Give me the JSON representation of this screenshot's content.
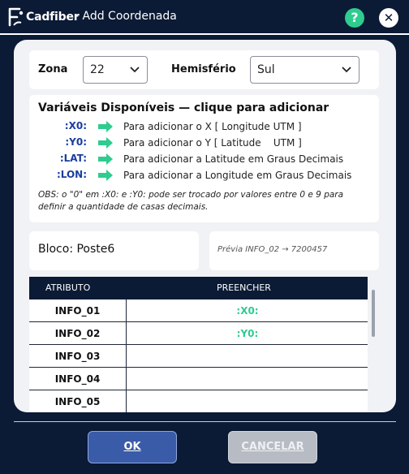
{
  "app": {
    "logo_text": "Cadfiber",
    "window_title": "- Add Coordenada",
    "help_glyph": "?",
    "close_glyph": "✕"
  },
  "zona": {
    "label": "Zona",
    "value": "22"
  },
  "hemisferio": {
    "label": "Hemisfério",
    "value": "Sul"
  },
  "variables": {
    "title": "Variáveis Disponíveis — clique para adicionar",
    "items": [
      {
        "code": ":X0:",
        "desc": "Para adicionar o X [ Longitude UTM ]"
      },
      {
        "code": ":Y0:",
        "desc": "Para adicionar o Y [ Latitude    UTM ]"
      },
      {
        "code": ":LAT:",
        "desc": "Para adicionar a Latitude em Graus Decimais"
      },
      {
        "code": ":LON:",
        "desc": "Para adicionar a Longitude em Graus Decimais"
      }
    ],
    "obs": "OBS: o \"0\" em :X0: e :Y0: pode ser trocado por valores entre 0 e 9 para definir a quantidade de casas decimais."
  },
  "bloco": {
    "text": "Bloco: Poste6"
  },
  "previa": {
    "text": "Prévia INFO_02 → 7200457"
  },
  "table": {
    "headers": [
      "ATRIBUTO",
      "PREENCHER"
    ],
    "rows": [
      {
        "attr": "INFO_01",
        "value": ":X0:"
      },
      {
        "attr": "INFO_02",
        "value": ":Y0:"
      },
      {
        "attr": "INFO_03",
        "value": ""
      },
      {
        "attr": "INFO_04",
        "value": ""
      },
      {
        "attr": "INFO_05",
        "value": ""
      }
    ]
  },
  "buttons": {
    "ok": "OK",
    "cancel": "CANCELAR"
  },
  "colors": {
    "navy": "#0b1a35",
    "accent_green": "#2ecc8f",
    "code_blue": "#1a3ea0",
    "ok_blue": "#3a5ba8"
  },
  "icons": [
    "cadfiber-logo-icon",
    "help-icon",
    "close-icon",
    "chevron-down-icon",
    "green-arrow-icon"
  ]
}
